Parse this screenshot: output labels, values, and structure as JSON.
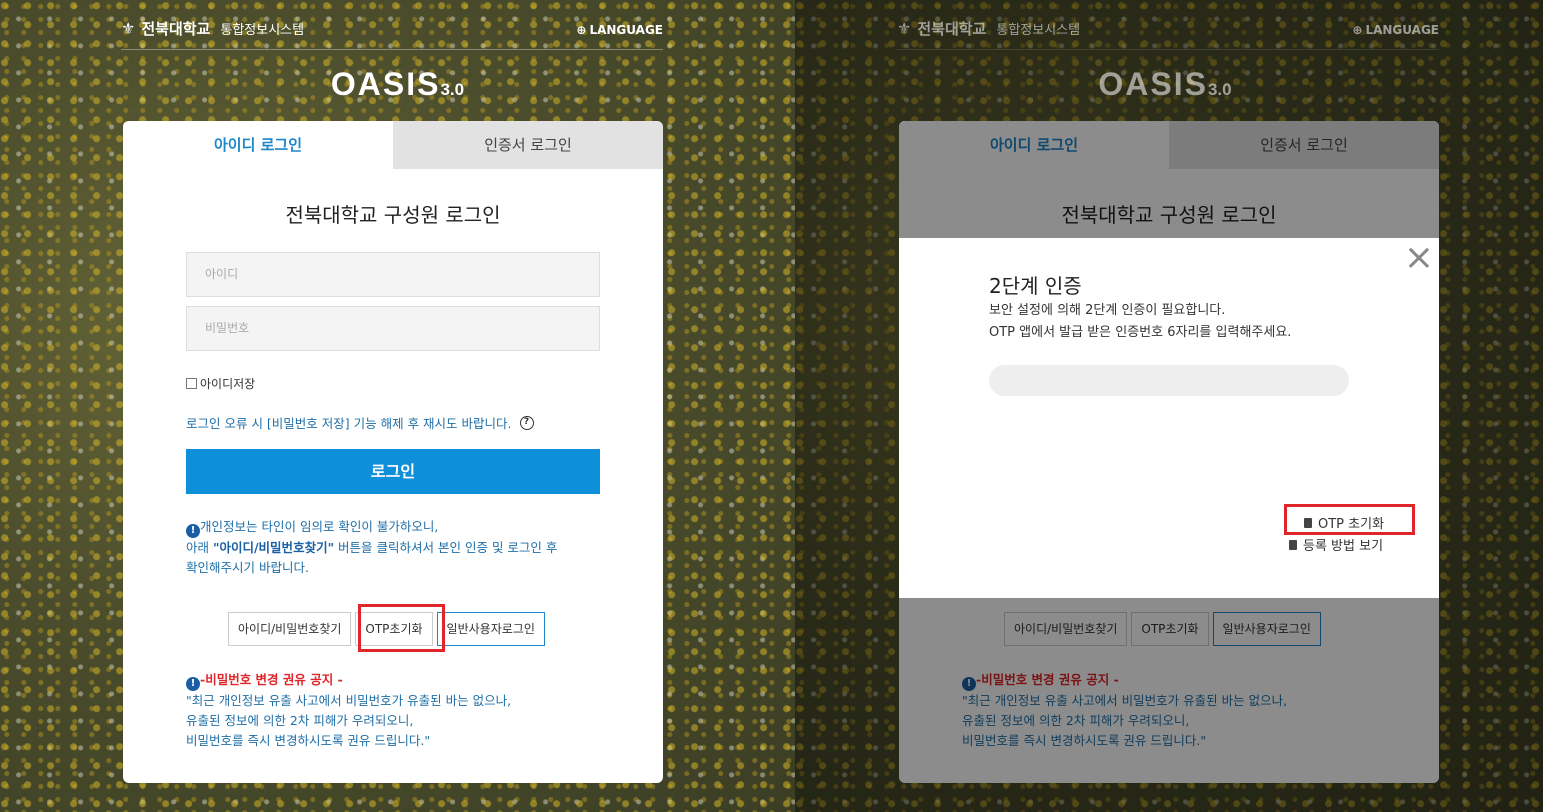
{
  "header": {
    "university": "전북대학교",
    "system": "통합정보시스템",
    "language": "LANGUAGE"
  },
  "brand": {
    "name": "OASIS",
    "version": "3.0"
  },
  "tabs": {
    "id_login": "아이디 로그인",
    "cert_login": "인증서 로그인"
  },
  "login": {
    "title": "전북대학교 구성원 로그인",
    "id_placeholder": "아이디",
    "pw_placeholder": "비밀번호",
    "remember": "아이디저장",
    "hint": "로그인 오류 시 [비밀번호 저장] 기능 해제 후 재시도 바랍니다.",
    "button": "로그인"
  },
  "notice": {
    "line1": "개인정보는 타인이 임의로 확인이 불가하오니,",
    "line2_pre": "아래 ",
    "line2_bold": "\"아이디/비밀번호찾기\"",
    "line2_post": " 버튼을 클릭하셔서 본인 인증 및 로그인 후",
    "line3": "확인해주시기 바랍니다."
  },
  "buttons": {
    "find": "아이디/비밀번호찾기",
    "otp_reset": "OTP초기화",
    "general": "일반사용자로그인"
  },
  "warning": {
    "title": "-비밀번호 변경 권유 공지 -",
    "line1": "\"최근 개인정보 유출 사고에서 비밀번호가 유출된 바는 없으나,",
    "line2": "유출된 정보에 의한 2차 피해가 우려되오니,",
    "line3": "비밀번호를 즉시 변경하시도록 권유 드립니다.\""
  },
  "modal": {
    "title": "2단계 인증",
    "desc1": "보안 설정에 의해 2단계 인증이 필요합니다.",
    "desc2": "OTP 앱에서 발급 받은 인증번호 6자리를 입력해주세요.",
    "otp_reset": "OTP 초기화",
    "register_help": "등록 방법 보기",
    "close": "×"
  },
  "colors": {
    "accent": "#0d8fd9",
    "highlight": "#e0262b",
    "link": "#1f6fa8"
  }
}
